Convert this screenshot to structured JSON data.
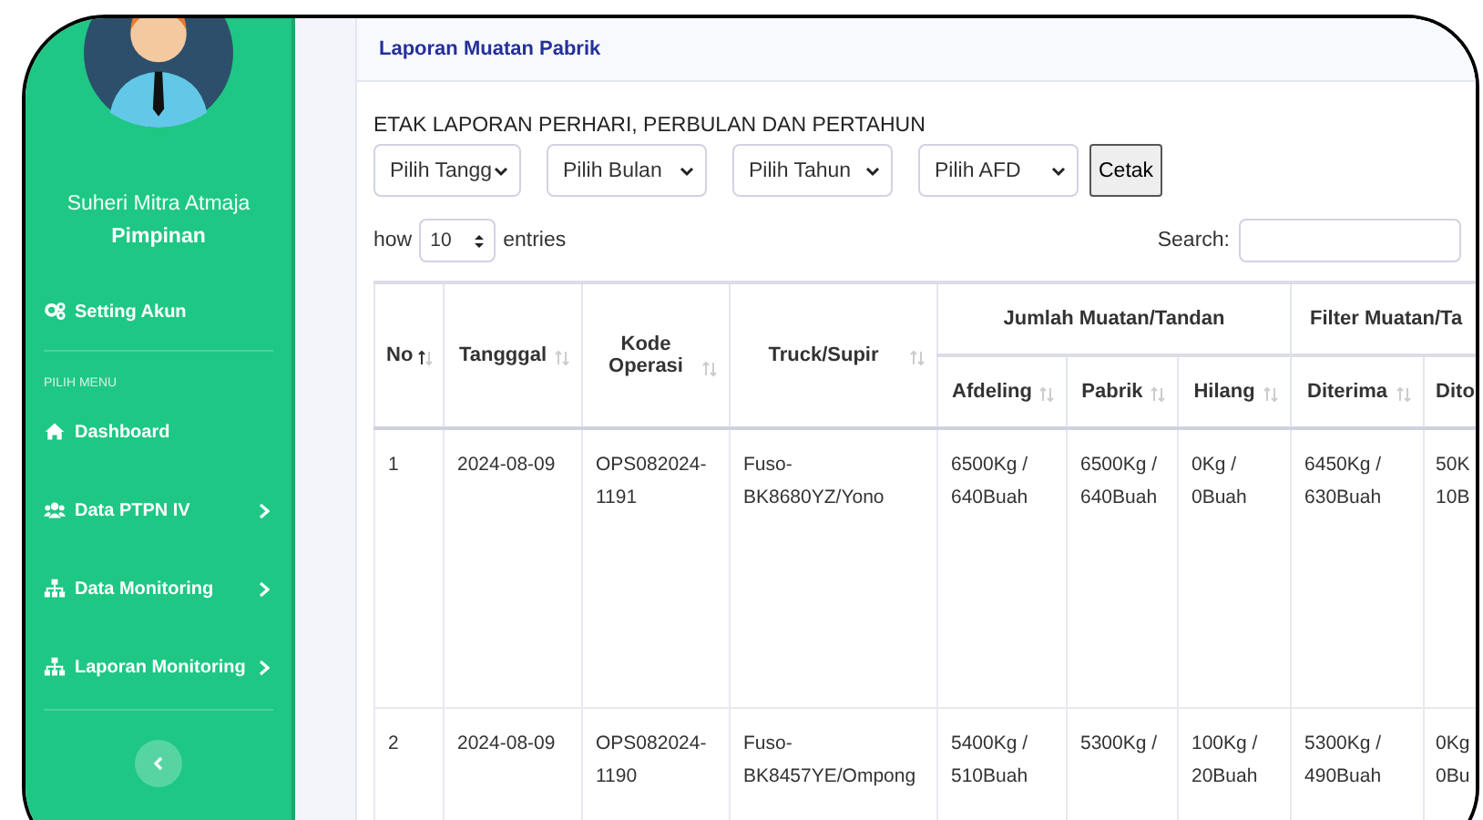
{
  "sidebar": {
    "user_name": "Suheri Mitra Atmaja",
    "user_role": "Pimpinan",
    "account_item": {
      "label": "Setting Akun",
      "kind": "settings"
    },
    "section_label": "PILIH MENU",
    "items": [
      {
        "label": "Dashboard",
        "kind": "home",
        "has_submenu": false
      },
      {
        "label": "Data PTPN IV",
        "kind": "people",
        "has_submenu": true
      },
      {
        "label": "Data Monitoring",
        "kind": "tree",
        "has_submenu": true
      },
      {
        "label": "Laporan Monitoring",
        "kind": "tree",
        "has_submenu": true
      }
    ]
  },
  "card": {
    "title": "Laporan Muatan Pabrik",
    "print_heading": "ETAK LAPORAN PERHARI, PERBULAN DAN PERTAHUN",
    "filters": [
      {
        "value": "Pilih Tangg"
      },
      {
        "value": "Pilih Bulan"
      },
      {
        "value": "Pilih Tahun"
      },
      {
        "value": "Pilih AFD"
      }
    ],
    "print_button": "Cetak",
    "length": {
      "prefix": "how",
      "value": "10",
      "suffix": "entries"
    },
    "search": {
      "label": "Search:"
    },
    "table": {
      "columns": [
        {
          "label": "No",
          "sorted": true
        },
        {
          "label": "Tangggal",
          "sorted": false
        },
        {
          "label": "Kode Operasi",
          "sorted": false
        },
        {
          "label": "Truck/Supir",
          "sorted": false
        }
      ],
      "groups": [
        {
          "label": "Jumlah Muatan/Tandan",
          "columns": [
            {
              "label": "Afdeling",
              "sorted": false
            },
            {
              "label": "Pabrik",
              "sorted": false
            },
            {
              "label": "Hilang",
              "sorted": false
            }
          ]
        },
        {
          "label": "Filter Muatan/Ta",
          "columns": [
            {
              "label": "Diterima",
              "sorted": false
            },
            {
              "label": "Dito"
            }
          ]
        }
      ],
      "rows": [
        [
          "1",
          "2024-08-09",
          "OPS082024-1191",
          "Fuso-BK8680YZ/Yono",
          "6500Kg / 640Buah",
          "6500Kg / 640Buah",
          "0Kg / 0Buah",
          "6450Kg / 630Buah",
          "50K\n10B"
        ],
        [
          "2",
          "2024-08-09",
          "OPS082024-1190",
          "Fuso-BK8457YE/Ompong",
          "5400Kg / 510Buah",
          "5300Kg /",
          "100Kg / 20Buah",
          "5300Kg / 490Buah",
          "0Kg\n0Bu"
        ]
      ]
    }
  }
}
